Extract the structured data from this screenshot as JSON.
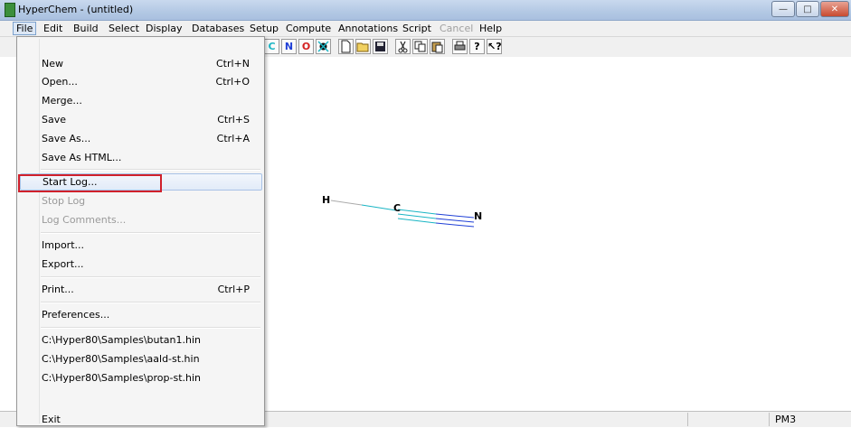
{
  "window": {
    "title": "HyperChem - (untitled)"
  },
  "menubar": [
    {
      "label": "File",
      "state": "active"
    },
    {
      "label": "Edit",
      "state": "normal"
    },
    {
      "label": "Build",
      "state": "normal"
    },
    {
      "label": "Select",
      "state": "normal"
    },
    {
      "label": "Display",
      "state": "normal"
    },
    {
      "label": "Databases",
      "state": "normal"
    },
    {
      "label": "Setup",
      "state": "normal"
    },
    {
      "label": "Compute",
      "state": "normal"
    },
    {
      "label": "Annotations",
      "state": "normal"
    },
    {
      "label": "Script",
      "state": "normal"
    },
    {
      "label": "Cancel",
      "state": "disabled"
    },
    {
      "label": "Help",
      "state": "normal"
    }
  ],
  "toolbar": {
    "element_buttons": [
      "C",
      "N",
      "O"
    ],
    "element_colors": {
      "C": "#1ab5c4",
      "N": "#1f3fd6",
      "O": "#d42020"
    },
    "icons": [
      "mark-icon",
      "new-file-icon",
      "open-folder-icon",
      "save-disk-icon",
      "cut-icon",
      "copy-icon",
      "paste-icon",
      "print-icon",
      "help-icon",
      "context-help-icon"
    ]
  },
  "file_menu": {
    "items": [
      {
        "label": "New",
        "shortcut": "Ctrl+N",
        "enabled": true
      },
      {
        "label": "Open...",
        "shortcut": "Ctrl+O",
        "enabled": true
      },
      {
        "label": "Merge...",
        "shortcut": "",
        "enabled": true
      },
      {
        "label": "Save",
        "shortcut": "Ctrl+S",
        "enabled": true
      },
      {
        "label": "Save As...",
        "shortcut": "Ctrl+A",
        "enabled": true
      },
      {
        "label": "Save As HTML...",
        "shortcut": "",
        "enabled": true
      },
      {
        "label": "Start Log...",
        "shortcut": "",
        "enabled": true,
        "highlighted": true
      },
      {
        "label": "Stop Log",
        "shortcut": "",
        "enabled": false
      },
      {
        "label": "Log Comments...",
        "shortcut": "",
        "enabled": false
      },
      {
        "label": "Import...",
        "shortcut": "",
        "enabled": true
      },
      {
        "label": "Export...",
        "shortcut": "",
        "enabled": true
      },
      {
        "label": "Print...",
        "shortcut": "Ctrl+P",
        "enabled": true
      },
      {
        "label": "Preferences...",
        "shortcut": "",
        "enabled": true
      },
      {
        "label": "C:\\Hyper80\\Samples\\butan1.hin",
        "shortcut": "",
        "enabled": true
      },
      {
        "label": "C:\\Hyper80\\Samples\\aald-st.hin",
        "shortcut": "",
        "enabled": true
      },
      {
        "label": "C:\\Hyper80\\Samples\\prop-st.hin",
        "shortcut": "",
        "enabled": true
      },
      {
        "label": "Exit",
        "shortcut": "",
        "enabled": true
      }
    ]
  },
  "molecule": {
    "atoms": [
      "H",
      "C",
      "N"
    ],
    "colors": {
      "H": "#000000",
      "C": "#1ab5c4",
      "N": "#1f3fd6",
      "bond_light": "#aaaaaa"
    }
  },
  "status": {
    "method": "PM3"
  },
  "highlight_color": "#d0202b"
}
